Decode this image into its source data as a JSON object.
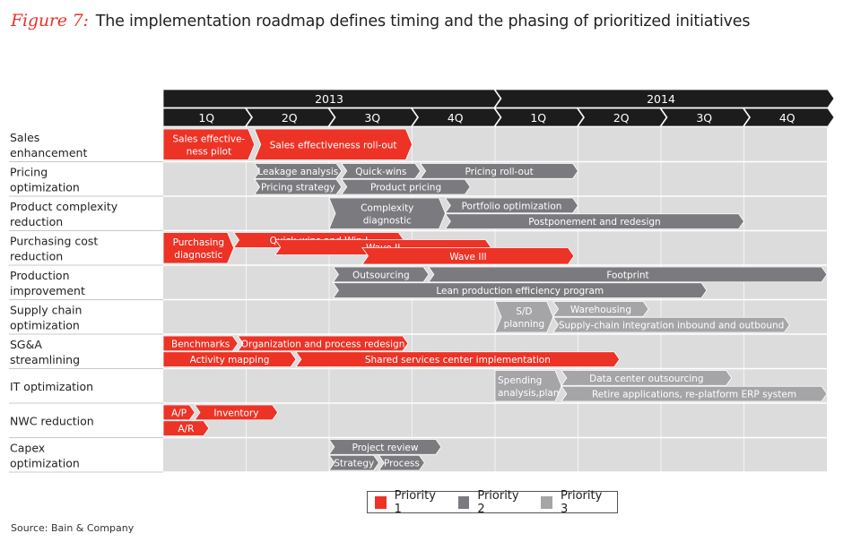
{
  "title": {
    "figure_label": "Figure 7:",
    "text": "The implementation roadmap defines timing and the phasing of prioritized initiatives"
  },
  "colors": {
    "priority1": "#ec3326",
    "priority2": "#7b7b7f",
    "priority3": "#a5a5a8",
    "header": "#1c1c1c",
    "grid_bg": "#dcdcdd"
  },
  "chart_data": {
    "type": "gantt",
    "years": [
      {
        "label": "2013",
        "start": 0,
        "end": 4
      },
      {
        "label": "2014",
        "start": 4,
        "end": 8
      }
    ],
    "quarters": [
      "1Q",
      "2Q",
      "3Q",
      "4Q",
      "1Q",
      "2Q",
      "3Q",
      "4Q"
    ],
    "units": "quarters from start of 2013",
    "rows": [
      {
        "label": [
          "Sales",
          "enhancement"
        ],
        "tasks": [
          {
            "label": [
              "Sales effective-",
              "ness pilot"
            ],
            "priority": 1,
            "start": 0,
            "end": 1.1,
            "lane": "full"
          },
          {
            "label": [
              "Sales effectiveness roll-out"
            ],
            "priority": 1,
            "start": 1.1,
            "end": 3.0,
            "lane": "full"
          }
        ]
      },
      {
        "label": [
          "Pricing",
          "optimization"
        ],
        "tasks": [
          {
            "label": [
              "Leakage analysis"
            ],
            "priority": 2,
            "start": 1.1,
            "end": 2.15,
            "lane": "top"
          },
          {
            "label": [
              "Quick-wins"
            ],
            "priority": 2,
            "start": 2.15,
            "end": 3.1,
            "lane": "top"
          },
          {
            "label": [
              "Pricing roll-out"
            ],
            "priority": 2,
            "start": 3.1,
            "end": 5.0,
            "lane": "top"
          },
          {
            "label": [
              "Pricing strategy"
            ],
            "priority": 2,
            "start": 1.1,
            "end": 2.15,
            "lane": "bottom"
          },
          {
            "label": [
              "Product pricing"
            ],
            "priority": 2,
            "start": 2.15,
            "end": 3.7,
            "lane": "bottom"
          }
        ]
      },
      {
        "label": [
          "Product complexity",
          "reduction"
        ],
        "tasks": [
          {
            "label": [
              "Complexity",
              "diagnostic"
            ],
            "priority": 2,
            "start": 2.0,
            "end": 3.4,
            "lane": "full"
          },
          {
            "label": [
              "Portfolio optimization"
            ],
            "priority": 2,
            "start": 3.4,
            "end": 5.0,
            "lane": "top"
          },
          {
            "label": [
              "Postponement and redesign"
            ],
            "priority": 2,
            "start": 3.4,
            "end": 7.0,
            "lane": "bottom"
          }
        ]
      },
      {
        "label": [
          "Purchasing cost",
          "reduction"
        ],
        "tasks": [
          {
            "label": [
              "Purchasing",
              "diagnostic"
            ],
            "priority": 1,
            "start": 0,
            "end": 0.85,
            "lane": "full"
          },
          {
            "label": [
              "Quick-wins and Win I"
            ],
            "priority": 1,
            "start": 0.85,
            "end": 2.9,
            "lane": "wave1"
          },
          {
            "label": [
              "Wave II"
            ],
            "priority": 1,
            "start": 1.35,
            "end": 3.95,
            "lane": "wave2"
          },
          {
            "label": [
              "Wave III"
            ],
            "priority": 1,
            "start": 2.4,
            "end": 4.95,
            "lane": "wave3"
          }
        ]
      },
      {
        "label": [
          "Production",
          "improvement"
        ],
        "tasks": [
          {
            "label": [
              "Outsourcing"
            ],
            "priority": 2,
            "start": 2.05,
            "end": 3.2,
            "lane": "top"
          },
          {
            "label": [
              "Footprint"
            ],
            "priority": 2,
            "start": 3.2,
            "end": 8.0,
            "lane": "top"
          },
          {
            "label": [
              "Lean production efficiency program"
            ],
            "priority": 2,
            "start": 2.05,
            "end": 6.55,
            "lane": "bottom"
          }
        ]
      },
      {
        "label": [
          "Supply chain",
          "optimization"
        ],
        "tasks": [
          {
            "label": [
              "S/D",
              "planning"
            ],
            "priority": 3,
            "start": 4.0,
            "end": 4.7,
            "lane": "full"
          },
          {
            "label": [
              "Warehousing"
            ],
            "priority": 3,
            "start": 4.7,
            "end": 5.85,
            "lane": "top"
          },
          {
            "label": [
              "Supply-chain integration inbound and outbound"
            ],
            "priority": 3,
            "start": 4.7,
            "end": 7.55,
            "lane": "bottom"
          }
        ]
      },
      {
        "label": [
          "SG&A",
          "streamlining"
        ],
        "tasks": [
          {
            "label": [
              "Benchmarks"
            ],
            "priority": 1,
            "start": 0,
            "end": 0.9,
            "lane": "top"
          },
          {
            "label": [
              "Organization and process redesign"
            ],
            "priority": 1,
            "start": 0.9,
            "end": 2.95,
            "lane": "top"
          },
          {
            "label": [
              "Activity mapping"
            ],
            "priority": 1,
            "start": 0,
            "end": 1.6,
            "lane": "bottom"
          },
          {
            "label": [
              "Shared services center implementation"
            ],
            "priority": 1,
            "start": 1.6,
            "end": 5.5,
            "lane": "bottom"
          }
        ]
      },
      {
        "label": [
          "IT optimization"
        ],
        "tasks": [
          {
            "label": [
              "Spending",
              "analysis,plan"
            ],
            "priority": 3,
            "start": 4.0,
            "end": 4.8,
            "lane": "full-left"
          },
          {
            "label": [
              "Data center outsourcing"
            ],
            "priority": 3,
            "start": 4.8,
            "end": 6.85,
            "lane": "top"
          },
          {
            "label": [
              "Retire applications, re-platform ERP system"
            ],
            "priority": 3,
            "start": 4.8,
            "end": 8.0,
            "lane": "bottom"
          }
        ]
      },
      {
        "label": [
          "NWC reduction"
        ],
        "tasks": [
          {
            "label": [
              "A/P"
            ],
            "priority": 1,
            "start": 0,
            "end": 0.38,
            "lane": "top"
          },
          {
            "label": [
              "Inventory"
            ],
            "priority": 1,
            "start": 0.38,
            "end": 1.38,
            "lane": "top"
          },
          {
            "label": [
              "A/R"
            ],
            "priority": 1,
            "start": 0,
            "end": 0.55,
            "lane": "bottom"
          }
        ]
      },
      {
        "label": [
          "Capex",
          "optimization"
        ],
        "tasks": [
          {
            "label": [
              "Project review"
            ],
            "priority": 2,
            "start": 2.0,
            "end": 3.35,
            "lane": "top"
          },
          {
            "label": [
              "Strategy"
            ],
            "priority": 2,
            "start": 2.0,
            "end": 2.6,
            "lane": "bottom"
          },
          {
            "label": [
              "Process"
            ],
            "priority": 2,
            "start": 2.6,
            "end": 3.15,
            "lane": "bottom"
          }
        ]
      }
    ],
    "legend": [
      {
        "label": "Priority 1",
        "priority": 1
      },
      {
        "label": "Priority 2",
        "priority": 2
      },
      {
        "label": "Priority 3",
        "priority": 3
      }
    ],
    "legend_position": "bottom-center"
  },
  "source": "Source: Bain & Company"
}
